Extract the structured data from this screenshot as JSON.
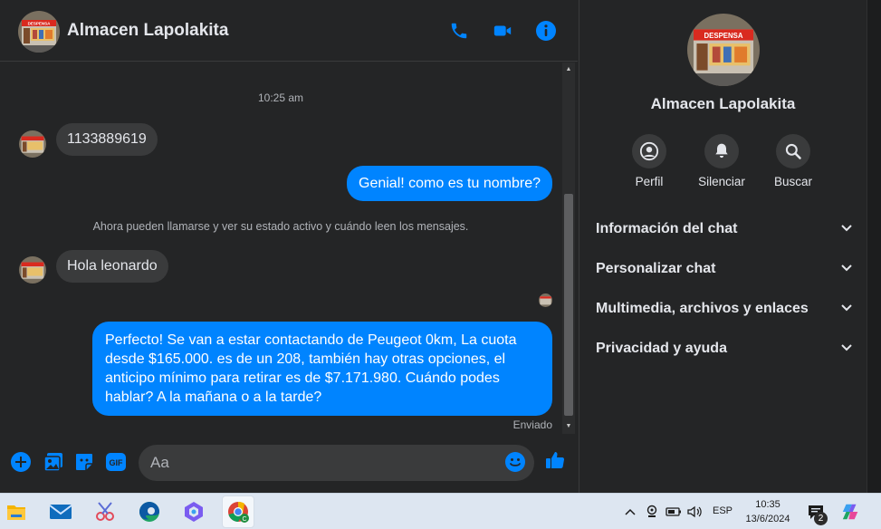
{
  "header": {
    "contact_name": "Almacen Lapolakita",
    "shop_sign": "DESPENSA",
    "icons": [
      "phone-icon",
      "video-call-icon",
      "info-icon"
    ],
    "accent_color": "#0084ff"
  },
  "messages": {
    "timestamp": "10:25 am",
    "incoming_1": "1133889619",
    "outgoing_1": "Genial! como es tu nombre?",
    "system_note": "Ahora pueden llamarse y ver su estado activo y cuándo leen los mensajes.",
    "incoming_2": "Hola leonardo",
    "outgoing_2": "Perfecto!  Se van a estar contactando de Peugeot 0km, La cuota desde $165.000. es de un 208, también hay otras opciones, el anticipo mínimo para retirar es de $7.171.980. Cuándo podes hablar? A la mañana o a la tarde?",
    "delivery_status": "Enviado"
  },
  "composer": {
    "placeholder": "Aa",
    "icons": [
      "add-icon",
      "photo-icon",
      "sticker-icon",
      "gif-icon",
      "emoji-icon",
      "like-icon"
    ],
    "gif_label": "GIF"
  },
  "details": {
    "name": "Almacen Lapolakita",
    "actions": [
      {
        "label": "Perfil",
        "icon": "profile-icon"
      },
      {
        "label": "Silenciar",
        "icon": "bell-icon"
      },
      {
        "label": "Buscar",
        "icon": "search-icon"
      }
    ],
    "sections": [
      {
        "label": "Información del chat"
      },
      {
        "label": "Personalizar chat"
      },
      {
        "label": "Multimedia, archivos y enlaces"
      },
      {
        "label": "Privacidad y ayuda"
      }
    ]
  },
  "taskbar": {
    "apps": [
      "file-explorer-icon",
      "mail-icon",
      "snipping-tool-icon",
      "edge-icon",
      "copilot-icon",
      "chrome-icon"
    ],
    "language": "ESP",
    "time": "10:35",
    "date": "13/6/2024",
    "notification_count": "2"
  }
}
